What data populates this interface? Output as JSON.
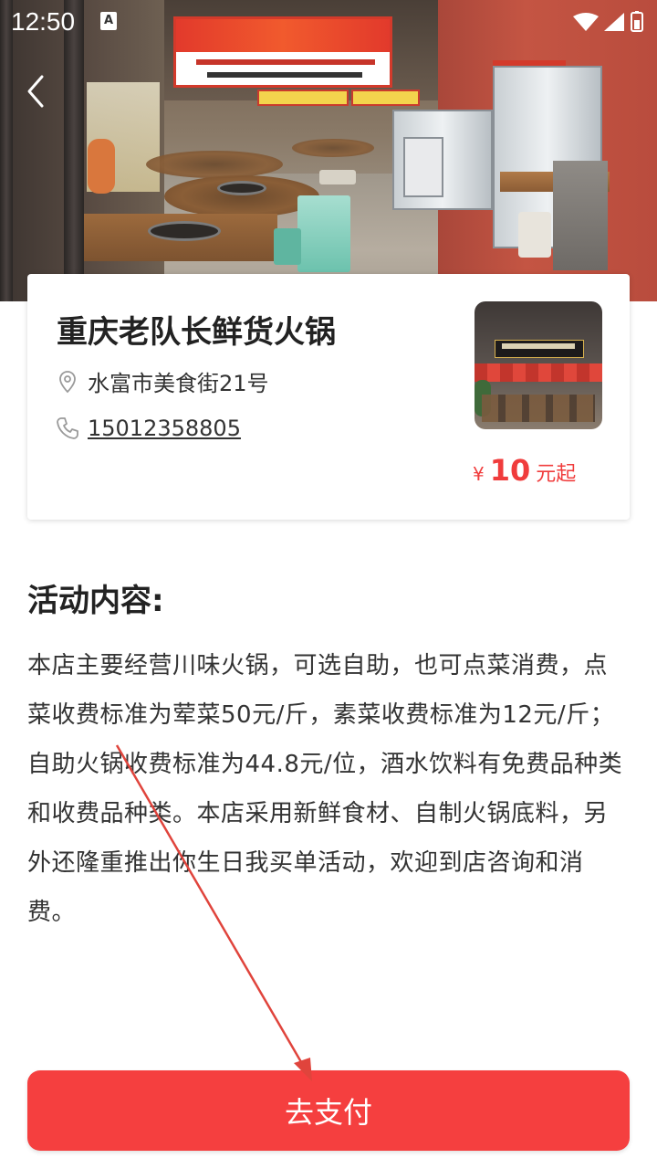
{
  "status_bar": {
    "time": "12:50",
    "notification_glyph": "A",
    "icons": [
      "wifi-icon",
      "signal-icon",
      "battery-icon"
    ]
  },
  "store": {
    "name": "重庆老队长鲜货火锅",
    "address": "水富市美食街21号",
    "phone": "15012358805",
    "price_symbol": "¥",
    "price_value": "10",
    "price_unit": "元起"
  },
  "activity": {
    "title": "活动内容:",
    "body": "本店主要经营川味火锅，可选自助，也可点菜消费，点菜收费标准为荤菜50元/斤，素菜收费标准为12元/斤；自助火锅收费标准为44.8元/位，酒水饮料有免费品种类和收费品种类。本店采用新鲜食材、自制火锅底料，另外还隆重推出你生日我买单活动，欢迎到店咨询和消费。"
  },
  "pay_button": {
    "label": "去支付"
  },
  "colors": {
    "accent": "#f53f3f",
    "price": "#f03c3c",
    "annotation_arrow": "#e0443c"
  }
}
